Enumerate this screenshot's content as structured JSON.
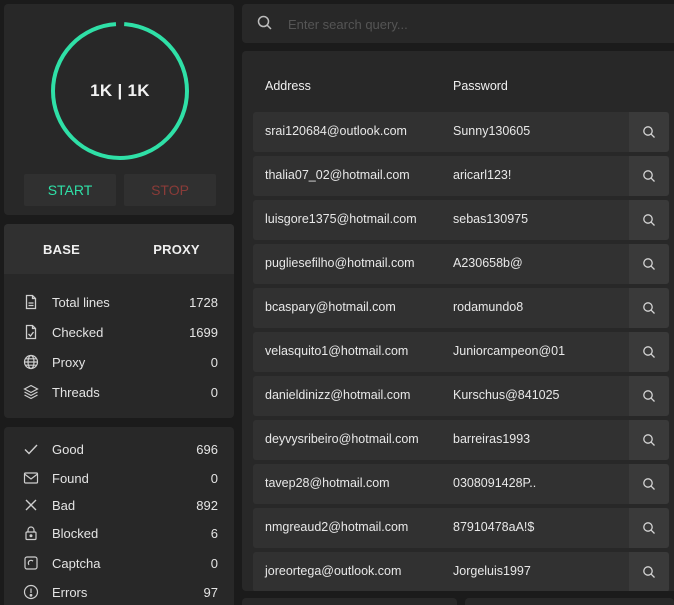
{
  "gauge": {
    "label": "1K | 1K",
    "progress": 0.98,
    "ring_color": "#2fe0a7"
  },
  "controls": {
    "start_label": "START",
    "stop_label": "STOP",
    "start_color": "#2fe0a7",
    "stop_color": "#8a3b38"
  },
  "tabs": [
    {
      "label": "BASE"
    },
    {
      "label": "PROXY"
    }
  ],
  "stats": [
    {
      "label": "Total lines",
      "value": "1728",
      "icon": "document-icon"
    },
    {
      "label": "Checked",
      "value": "1699",
      "icon": "document-check-icon"
    },
    {
      "label": "Proxy",
      "value": "0",
      "icon": "globe-icon"
    },
    {
      "label": "Threads",
      "value": "0",
      "icon": "layers-icon"
    }
  ],
  "results": [
    {
      "label": "Good",
      "value": "696",
      "icon": "check-icon"
    },
    {
      "label": "Found",
      "value": "0",
      "icon": "mail-icon"
    },
    {
      "label": "Bad",
      "value": "892",
      "icon": "x-icon"
    },
    {
      "label": "Blocked",
      "value": "6",
      "icon": "lock-icon"
    },
    {
      "label": "Captcha",
      "value": "0",
      "icon": "captcha-icon"
    },
    {
      "label": "Errors",
      "value": "97",
      "icon": "alert-icon"
    }
  ],
  "search": {
    "placeholder": "Enter search query..."
  },
  "table": {
    "headers": {
      "address": "Address",
      "password": "Password"
    },
    "rows": [
      {
        "address": "srai120684@outlook.com",
        "password": "Sunny130605"
      },
      {
        "address": "thalia07_02@hotmail.com",
        "password": "aricarl123!"
      },
      {
        "address": "luisgore1375@hotmail.com",
        "password": "sebas130975"
      },
      {
        "address": "pugliesefilho@hotmail.com",
        "password": "A230658b@"
      },
      {
        "address": "bcaspary@hotmail.com",
        "password": "rodamundo8"
      },
      {
        "address": "velasquito1@hotmail.com",
        "password": "Juniorcampeon@01"
      },
      {
        "address": "danieldinizz@hotmail.com",
        "password": "Kurschus@841025"
      },
      {
        "address": "deyvysribeiro@hotmail.com",
        "password": "barreiras1993"
      },
      {
        "address": "tavep28@hotmail.com",
        "password": "0308091428P.."
      },
      {
        "address": "nmgreaud2@hotmail.com",
        "password": "87910478aA!$"
      },
      {
        "address": "joreortega@outlook.com",
        "password": "Jorgeluis1997"
      }
    ]
  }
}
